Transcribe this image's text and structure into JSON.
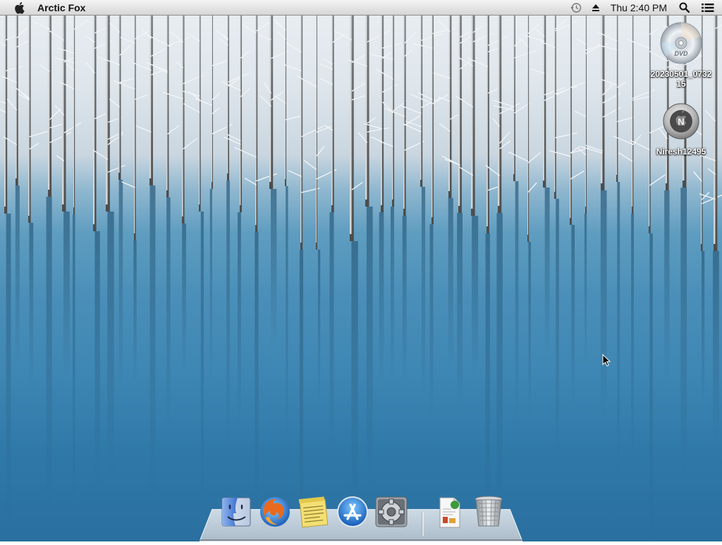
{
  "menubar": {
    "app_name": "Arctic Fox",
    "clock": "Thu 2:40 PM",
    "icons": [
      "apple-icon",
      "time-machine-icon",
      "eject-icon",
      "spotlight-icon",
      "notification-list-icon"
    ]
  },
  "desktop": {
    "items": [
      {
        "label": "20230501_073215",
        "icon": "dvd-disc-icon"
      },
      {
        "label": "Niresh12495",
        "icon": "install-disk-icon"
      }
    ]
  },
  "dock": {
    "items": [
      {
        "name": "Finder",
        "icon": "finder-icon"
      },
      {
        "name": "Arctic Fox",
        "icon": "browser-icon"
      },
      {
        "name": "Stickies",
        "icon": "stickies-icon"
      },
      {
        "name": "App Store",
        "icon": "app-store-icon"
      },
      {
        "name": "System Preferences",
        "icon": "system-preferences-icon"
      },
      {
        "name": "Documents",
        "icon": "documents-stack-icon"
      },
      {
        "name": "Trash",
        "icon": "trash-icon"
      }
    ]
  },
  "colors": {
    "menubar_top": "#f4f4f4",
    "menubar_bottom": "#d6d6d6",
    "water_light": "#8fb7cf",
    "water_dark": "#2a6f9f",
    "snow": "#e9eef2"
  }
}
